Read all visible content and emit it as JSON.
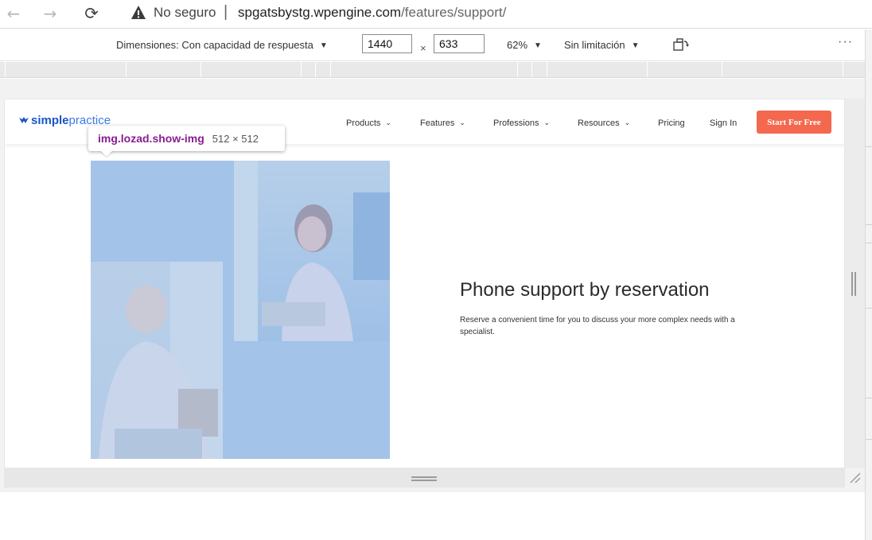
{
  "browser": {
    "security_label": "No seguro",
    "separator": "|",
    "url_host": "spgatsbystg.wpengine.com",
    "url_path": "/features/support/"
  },
  "device_toolbar": {
    "dimensions_label": "Dimensiones: Con capacidad de respuesta",
    "width_value": "1440",
    "times_symbol": "×",
    "height_value": "633",
    "zoom_label": "62%",
    "throttle_label": "Sin limitación",
    "more_label": "···"
  },
  "site": {
    "logo_bold": "simple",
    "logo_light": "practice",
    "nav": {
      "products": "Products",
      "features": "Features",
      "professions": "Professions",
      "resources": "Resources",
      "pricing": "Pricing",
      "sign_in": "Sign In"
    },
    "cta_label": "Start For Free",
    "feature_title": "Phone support by reservation",
    "feature_desc": "Reserve a convenient time for you to discuss your more complex needs with a specialist."
  },
  "inspector_tooltip": {
    "tag": "img.lozad.show-img",
    "size": "512 × 512"
  },
  "colors": {
    "cta": "#f4684e",
    "brand": "#1a56c4",
    "highlight_overlay": "#a3c3e9",
    "tooltip_tag": "#8a1c91"
  }
}
